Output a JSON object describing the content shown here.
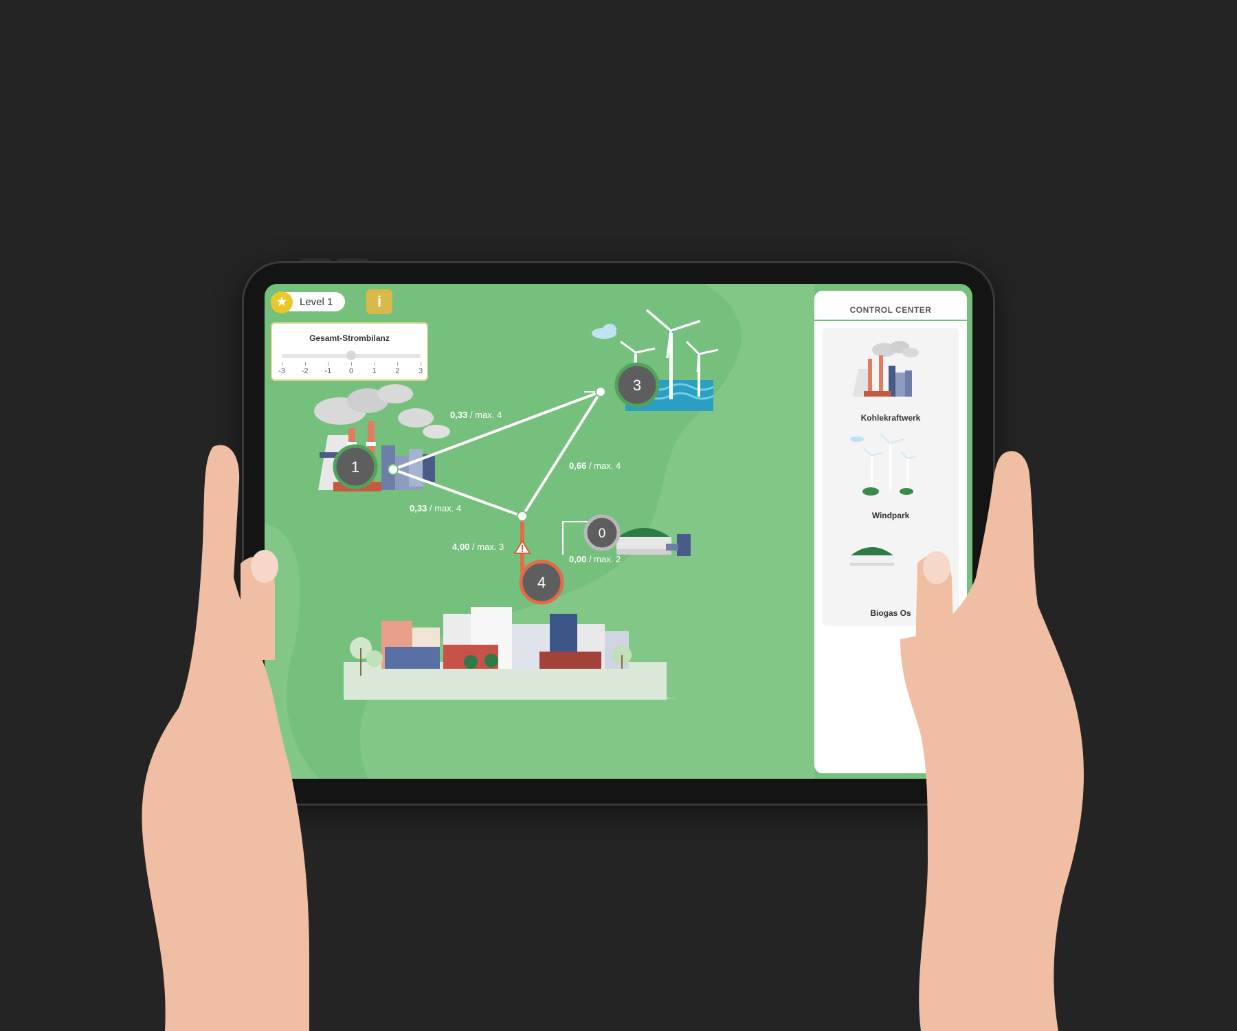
{
  "hud": {
    "level_label": "Level 1",
    "info_label": "i",
    "star_icon": "★"
  },
  "balance": {
    "title": "Gesamt-Strombilanz",
    "ticks": [
      "-3",
      "-2",
      "-1",
      "0",
      "1",
      "2",
      "3"
    ],
    "value": 0
  },
  "control_center": {
    "title": "CONTROL CENTER",
    "cards": [
      {
        "label": "Kohlekraftwerk",
        "icon": "coal-plant-icon"
      },
      {
        "label": "Windpark",
        "icon": "wind-park-icon"
      },
      {
        "label": "Biogas Os",
        "icon": "biogas-icon"
      }
    ]
  },
  "nodes": [
    {
      "id": "1",
      "label": "1",
      "status": "ok"
    },
    {
      "id": "3",
      "label": "3",
      "status": "ok"
    },
    {
      "id": "0",
      "label": "0",
      "status": "idle"
    },
    {
      "id": "4",
      "label": "4",
      "status": "overload"
    }
  ],
  "edges": [
    {
      "name": "edge-1-3",
      "value": "0,33",
      "max": "/ max. 4"
    },
    {
      "name": "edge-3-junction",
      "value": "0,66",
      "max": "/ max. 4"
    },
    {
      "name": "edge-1-junction",
      "value": "0,33",
      "max": "/ max. 4"
    },
    {
      "name": "edge-junction-4",
      "value": "4,00",
      "max": "/ max. 3",
      "warning": true
    },
    {
      "name": "edge-biogas-4",
      "value": "0,00",
      "max": "/ max. 2"
    }
  ],
  "colors": {
    "background": "#252424",
    "screen": "#76c07d",
    "node_ok_ring": "#4fa35a",
    "node_overload_ring": "#e56a4a",
    "node_idle_ring": "#b9b9b9",
    "node_fill": "#5e5e5e",
    "warning": "#e05b3a"
  }
}
